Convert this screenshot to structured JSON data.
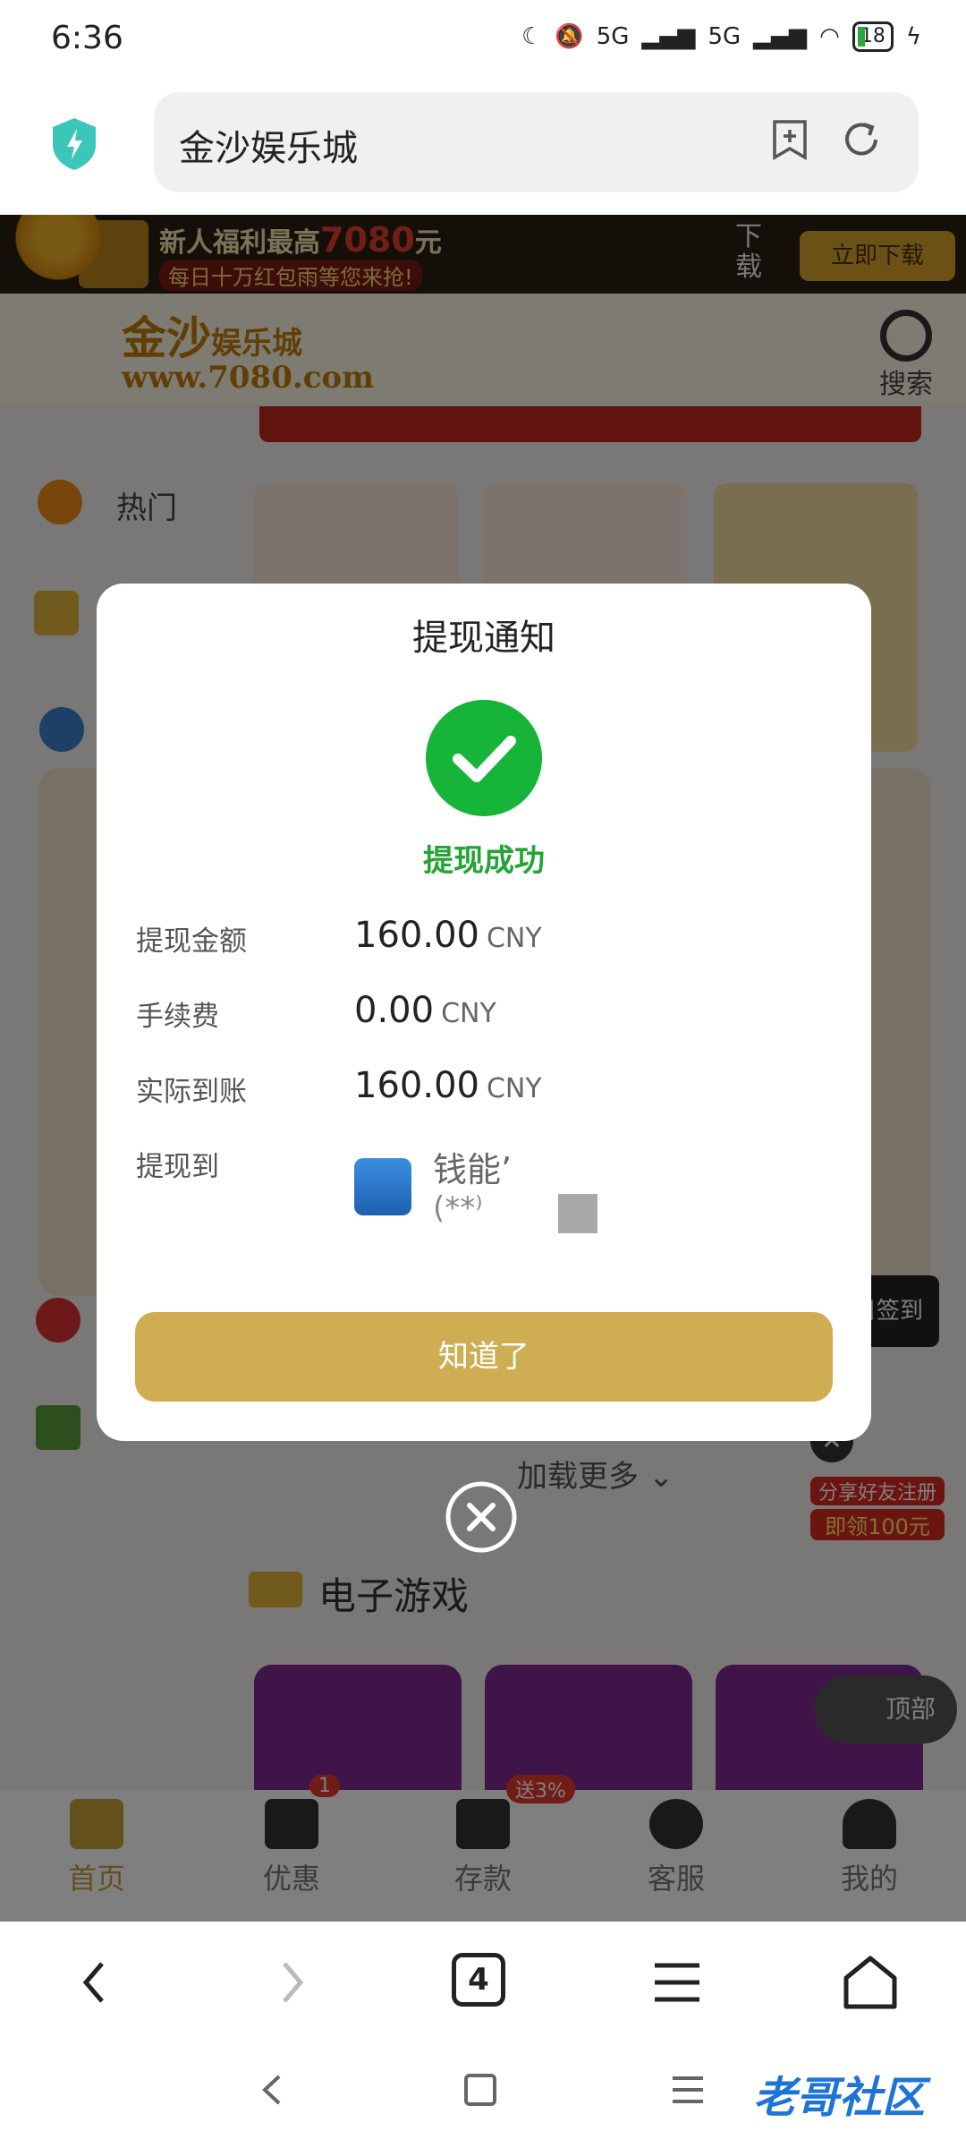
{
  "status_bar": {
    "time": "6:36",
    "signal1": "5G",
    "signal2": "5G",
    "battery": "18"
  },
  "browser": {
    "url_title": "金沙娱乐城"
  },
  "promo": {
    "line1_prefix": "新人福利最高",
    "line1_amount": "7080",
    "line1_suffix": "元",
    "line2": "每日十万红包雨等您来抢!",
    "download_text": "下载",
    "download_button": "立即下载"
  },
  "site": {
    "logo_text": "金沙",
    "logo_sub": "娱乐城",
    "logo_url": "www.7080.com",
    "search_label": "搜索",
    "categories": {
      "hot": "热门"
    },
    "load_more": "加载更多",
    "section_title": "电子游戏",
    "tabs": [
      {
        "label": "首页",
        "badge": ""
      },
      {
        "label": "优惠",
        "badge": "1"
      },
      {
        "label": "存款",
        "badge": "送3%"
      },
      {
        "label": "客服",
        "badge": ""
      },
      {
        "label": "我的",
        "badge": ""
      }
    ],
    "top_button": "顶部",
    "invite_line1": "分享好友注册",
    "invite_line2": "即领100元",
    "daily_checkin": "每日签到"
  },
  "dialog": {
    "title": "提现通知",
    "status": "提现成功",
    "rows": [
      {
        "label": "提现金额",
        "value": "160.00",
        "unit": "CNY"
      },
      {
        "label": "手续费",
        "value": "0.00",
        "unit": "CNY"
      },
      {
        "label": "实际到账",
        "value": "160.00",
        "unit": "CNY"
      }
    ],
    "destination_label": "提现到",
    "destination_name": "钱能’",
    "destination_account": "(**⁾",
    "confirm_button": "知道了"
  },
  "browser_nav": {
    "tab_count": "4"
  },
  "watermark": "老哥社区"
}
